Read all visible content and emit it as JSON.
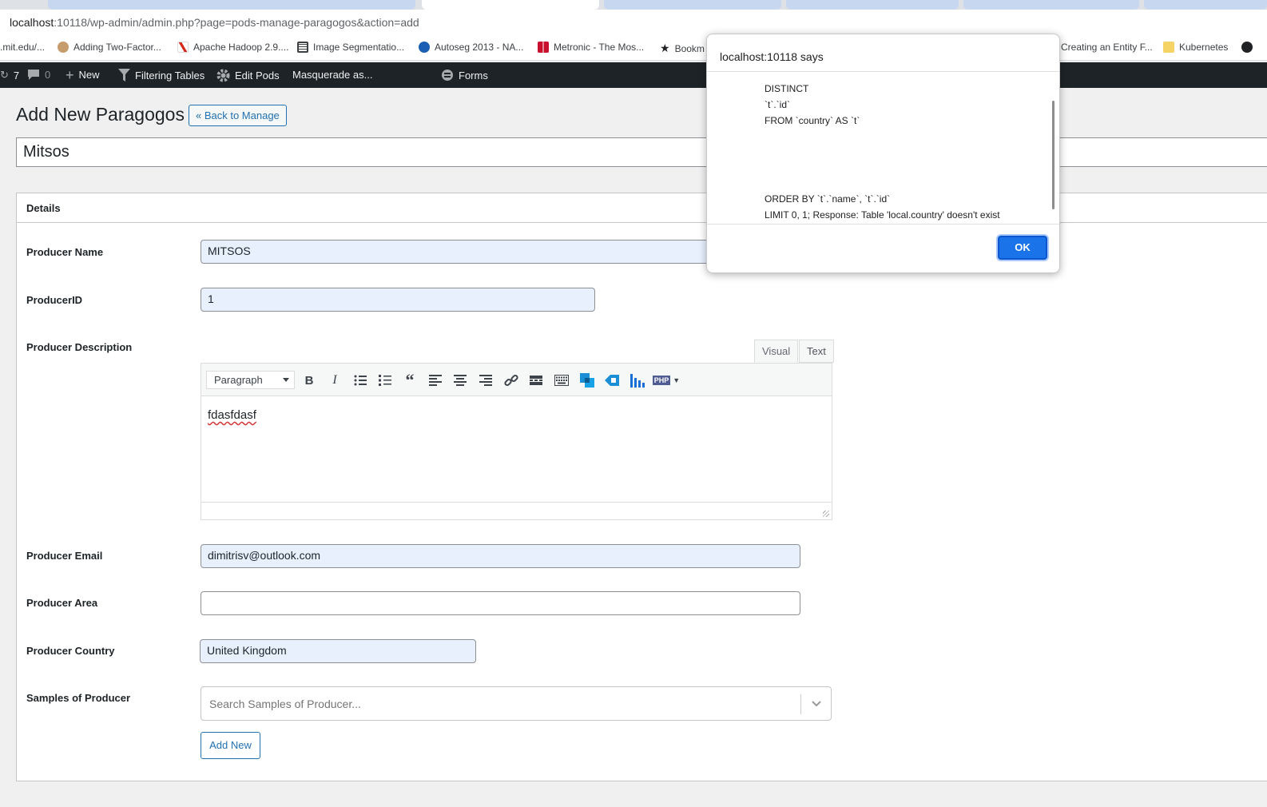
{
  "browser": {
    "url_host": "localhost",
    "url_rest": ":10118/wp-admin/admin.php?page=pods-manage-paragogos&action=add",
    "bookmarks": [
      {
        "label": ".mit.edu/...",
        "icon": "none"
      },
      {
        "label": "Adding Two-Factor...",
        "icon": "avatar-icon"
      },
      {
        "label": "Apache Hadoop 2.9....",
        "icon": "hadoop-icon"
      },
      {
        "label": "Image Segmentatio...",
        "icon": "book-icon"
      },
      {
        "label": "Autoseg 2013 - NA...",
        "icon": "autoseg-icon"
      },
      {
        "label": "Metronic - The Mos...",
        "icon": "metronic-icon"
      },
      {
        "label": "Bookm",
        "icon": "star-icon"
      },
      {
        "label": "Creating an Entity F...",
        "icon": "none"
      },
      {
        "label": "Kubernetes",
        "icon": "folder-icon"
      }
    ]
  },
  "adminbar": {
    "updates_count": "7",
    "comments_count": "0",
    "new_label": "New",
    "filtering_label": "Filtering Tables",
    "edit_pods_label": "Edit Pods",
    "masquerade_label": "Masquerade as...",
    "forms_label": "Forms"
  },
  "page": {
    "title": "Add New Paragogos",
    "back_label": "« Back to Manage",
    "name_value": "Mitsos"
  },
  "details": {
    "heading": "Details",
    "fields": {
      "producer_name": {
        "label": "Producer Name",
        "value": "MITSOS"
      },
      "producer_id": {
        "label": "ProducerID",
        "value": "1"
      },
      "producer_description": {
        "label": "Producer Description"
      },
      "producer_email": {
        "label": "Producer Email",
        "value": "dimitrisv@outlook.com"
      },
      "producer_area": {
        "label": "Producer Area",
        "value": ""
      },
      "producer_country": {
        "label": "Producer Country",
        "value": "United Kingdom"
      },
      "samples": {
        "label": "Samples of Producer",
        "placeholder": "Search Samples of Producer...",
        "add_label": "Add New"
      }
    }
  },
  "editor": {
    "tab_visual": "Visual",
    "tab_text": "Text",
    "format": "Paragraph",
    "content": "fdasfdasf"
  },
  "dialog": {
    "title": "localhost:10118 says",
    "lines": [
      "DISTINCT",
      "`t`.`id`",
      "FROM `country` AS `t`",
      "ORDER BY `t`.`name`, `t`.`id`",
      "LIMIT 0, 1; Response: Table 'local.country' doesn't exist"
    ],
    "ok_label": "OK"
  }
}
